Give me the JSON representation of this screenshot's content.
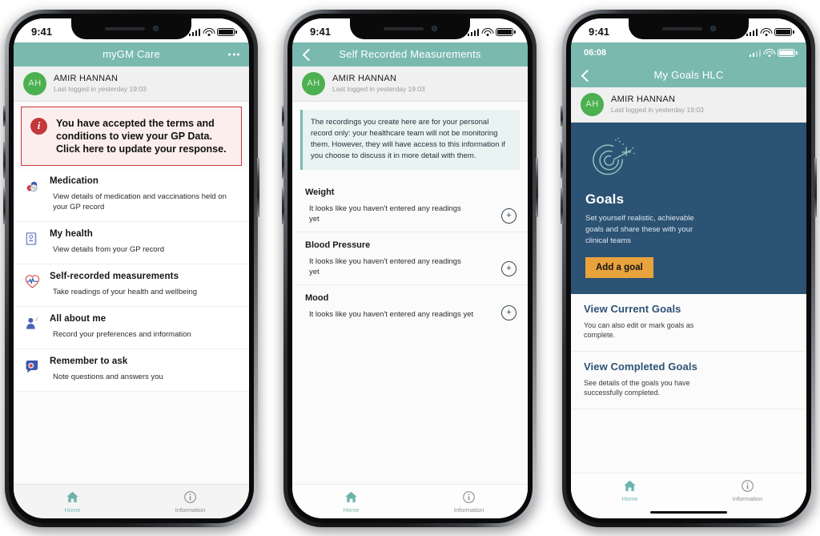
{
  "phones": [
    {
      "id": "phone-home",
      "status": {
        "time": "9:41",
        "signal": "signal-bars-icon",
        "wifi": "wifi-icon",
        "battery": "battery-icon"
      },
      "header": {
        "title": "myGM Care",
        "menu": "overflow-menu-icon",
        "back": null
      },
      "user": {
        "initials": "AH",
        "name": "AMIR HANNAN",
        "last_login": "Last logged in yesterday 19:03"
      },
      "alert": {
        "icon": "info-icon",
        "text": "You have accepted the terms and conditions to view your GP Data. Click here to update your response.",
        "border_color": "#c4383a",
        "background_color": "#fdeeee"
      },
      "list": [
        {
          "icon": "pills-icon",
          "title": "Medication",
          "desc": "View details of medication and vaccinations held on your GP record"
        },
        {
          "icon": "health-record-icon",
          "title": "My health",
          "desc": "View details from your GP record"
        },
        {
          "icon": "heart-pulse-icon",
          "title": "Self-recorded measurements",
          "desc": "Take readings of your health and wellbeing"
        },
        {
          "icon": "person-info-icon",
          "title": "All about me",
          "desc": "Record your preferences and information"
        },
        {
          "icon": "speech-bubble-icon",
          "title": "Remember to ask",
          "desc": "Note questions and answers you"
        }
      ],
      "tabs": [
        {
          "icon": "home-icon",
          "label": "Home",
          "active": true
        },
        {
          "icon": "information-icon",
          "label": "Information",
          "active": false
        }
      ],
      "home_indicator": false
    },
    {
      "id": "phone-measurements",
      "status": {
        "time": "9:41",
        "signal": "signal-bars-icon",
        "wifi": "wifi-icon",
        "battery": "battery-icon"
      },
      "header": {
        "title": "Self Recorded Measurements",
        "menu": null,
        "back": "back-chevron-icon"
      },
      "user": {
        "initials": "AH",
        "name": "AMIR HANNAN",
        "last_login": "Last logged in yesterday 19:03"
      },
      "note": "The recordings you create here are for your personal record only: your healthcare team will not be monitoring them. However, they will have access to this information if you choose to discuss it in more detail with them.",
      "measurements": [
        {
          "title": "Weight",
          "empty": "It looks like you haven't entered any readings yet",
          "add": "add-icon"
        },
        {
          "title": "Blood Pressure",
          "empty": "It looks like you haven't entered any readings yet",
          "add": "add-icon"
        },
        {
          "title": "Mood",
          "empty": "It looks like you haven't entered any readings yet",
          "add": "add-icon"
        }
      ],
      "tabs": [
        {
          "icon": "home-icon",
          "label": "Home",
          "active": true
        },
        {
          "icon": "information-icon",
          "label": "Information",
          "active": false
        }
      ],
      "home_indicator": false
    },
    {
      "id": "phone-goals",
      "status": {
        "time": "9:41",
        "signal": "signal-bars-icon",
        "wifi": "wifi-icon",
        "battery": "battery-icon"
      },
      "inner_status": {
        "time": "06:08",
        "signal": "signal-bars-icon",
        "wifi": "wifi-icon",
        "battery": "battery-icon"
      },
      "header": {
        "title": "My Goals HLC",
        "menu": null,
        "back": "back-chevron-icon"
      },
      "user": {
        "initials": "AH",
        "name": "AMIR HANNAN",
        "last_login": "Last logged in yesterday 19:03"
      },
      "hero": {
        "logo": "goals-target-c-icon",
        "title": "Goals",
        "desc": "Set yourself realistic, achievable goals and share these with your clinical teams",
        "button": "Add a goal",
        "background_color": "#2c5274",
        "button_color": "#e8a33d"
      },
      "goal_links": [
        {
          "title": "View Current Goals",
          "desc": "You can also edit or mark goals as complete."
        },
        {
          "title": "View Completed Goals",
          "desc": "See details of the goals you have successfully completed."
        }
      ],
      "tabs": [
        {
          "icon": "home-icon",
          "label": "Home",
          "active": true
        },
        {
          "icon": "information-icon",
          "label": "Information",
          "active": false
        }
      ],
      "home_indicator": true
    }
  ],
  "theme": {
    "teal": "#79b9b0",
    "navy": "#2c5274",
    "orange": "#e8a33d",
    "alert_red": "#c4383a",
    "avatar_green": "#4caf50"
  }
}
